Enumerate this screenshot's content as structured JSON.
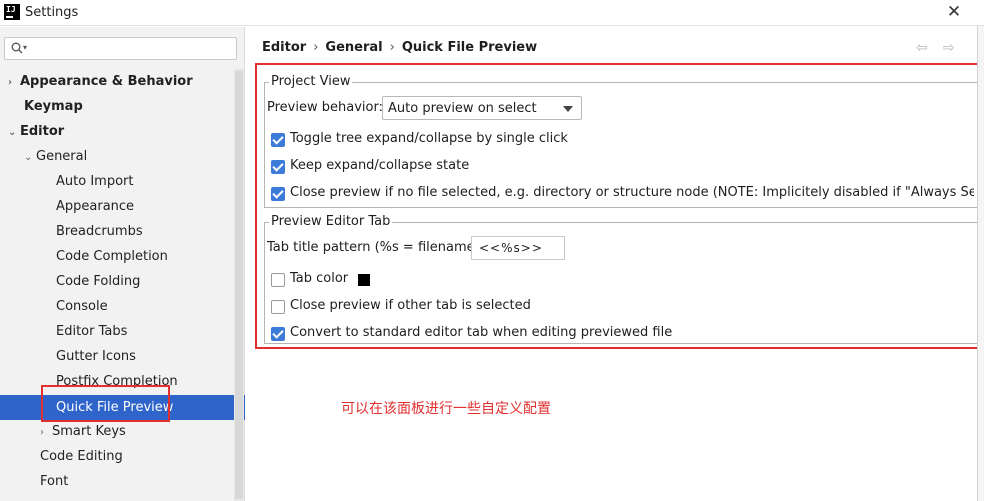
{
  "window": {
    "title": "Settings",
    "app_icon": "IJ"
  },
  "search": {
    "placeholder": ""
  },
  "sidebar": {
    "items": [
      {
        "label": "Appearance & Behavior",
        "arrow": "›"
      },
      {
        "label": "Keymap"
      },
      {
        "label": "Editor",
        "arrow": "⌄"
      },
      {
        "label": "General",
        "arrow": "⌄"
      },
      {
        "label": "Auto Import"
      },
      {
        "label": "Appearance"
      },
      {
        "label": "Breadcrumbs"
      },
      {
        "label": "Code Completion"
      },
      {
        "label": "Code Folding"
      },
      {
        "label": "Console"
      },
      {
        "label": "Editor Tabs"
      },
      {
        "label": "Gutter Icons"
      },
      {
        "label": "Postfix Completion"
      },
      {
        "label": "Quick File Preview"
      },
      {
        "label": "Smart Keys",
        "arrow": "›"
      },
      {
        "label": "Code Editing"
      },
      {
        "label": "Font"
      }
    ],
    "selected": "Quick File Preview"
  },
  "breadcrumb": {
    "part1": "Editor",
    "part2": "General",
    "part3": "Quick File Preview",
    "sep": "›"
  },
  "nav": {
    "back": "⇦",
    "forward": "⇨"
  },
  "project_view": {
    "title": "Project View",
    "preview_behavior_label": "Preview behavior:",
    "preview_behavior_value": "Auto preview on select",
    "toggle_tree": {
      "label": "Toggle tree expand/collapse by single click",
      "checked": true
    },
    "keep_state": {
      "label": "Keep expand/collapse state",
      "checked": true
    },
    "close_preview": {
      "label": "Close preview if no file selected, e.g. directory or structure node (NOTE: Implicitely disabled if \"Always Select Opened",
      "checked": true
    }
  },
  "preview_editor_tab": {
    "title": "Preview Editor Tab",
    "tab_title_pattern_label": "Tab title pattern (%s = filename):",
    "tab_title_pattern_value": "<<%s>>",
    "tab_color": {
      "label": "Tab color",
      "checked": false,
      "color": "#000000"
    },
    "close_other_tab": {
      "label": "Close preview if other tab is selected",
      "checked": false
    },
    "convert_tab": {
      "label": "Convert to standard editor tab when editing previewed file",
      "checked": true
    }
  },
  "annotation": "可以在该面板进行一些自定义配置",
  "colors": {
    "accent": "#2f65ca",
    "checkbox": "#3d7bd9",
    "highlight": "#e03030"
  }
}
